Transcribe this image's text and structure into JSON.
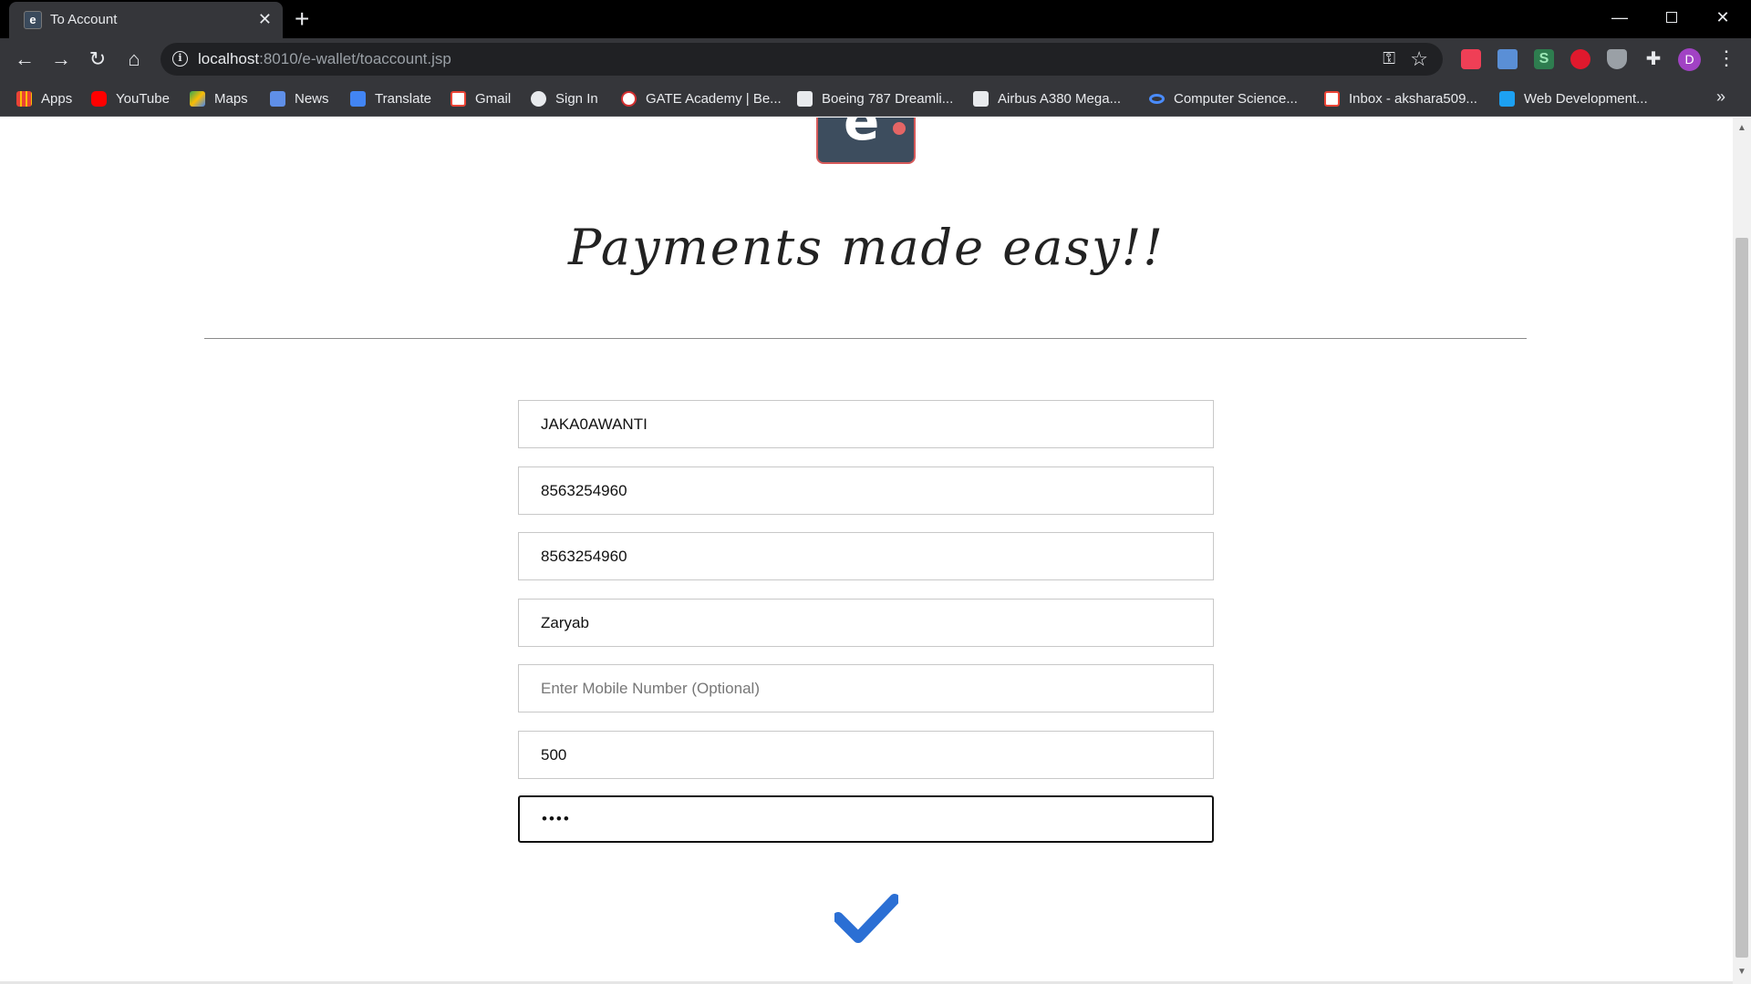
{
  "browser": {
    "tab_title": "To Account",
    "tab_favicon_letter": "e",
    "url_host": "localhost",
    "url_path": ":8010/e-wallet/toaccount.jsp",
    "avatar_letter": "D"
  },
  "bookmarks": [
    {
      "label": "Apps",
      "icon": "apps-grid-icon",
      "color": "#4285f4"
    },
    {
      "label": "YouTube",
      "icon": "youtube-icon",
      "color": "#ff0000"
    },
    {
      "label": "Maps",
      "icon": "maps-icon",
      "color": "#34a853"
    },
    {
      "label": "News",
      "icon": "news-icon",
      "color": "#4285f4"
    },
    {
      "label": "Translate",
      "icon": "translate-icon",
      "color": "#4285f4"
    },
    {
      "label": "Gmail",
      "icon": "gmail-icon",
      "color": "#ea4335"
    },
    {
      "label": "Sign In",
      "icon": "globe-icon",
      "color": "#e8eaed"
    },
    {
      "label": "GATE Academy | Be...",
      "icon": "gate-academy-icon",
      "color": "#d32f2f"
    },
    {
      "label": "Boeing 787 Dreamli...",
      "icon": "page-f-icon",
      "color": "#e8eaed"
    },
    {
      "label": "Airbus A380 Mega...",
      "icon": "page-f-icon",
      "color": "#e8eaed"
    },
    {
      "label": "Computer Science...",
      "icon": "coursera-icon",
      "color": "#4a8cff"
    },
    {
      "label": "Inbox - akshara509...",
      "icon": "gmail-icon",
      "color": "#ea4335"
    },
    {
      "label": "Web Development...",
      "icon": "is-icon",
      "color": "#1da1f2"
    }
  ],
  "page": {
    "heading": "Payments made easy!!",
    "fields": [
      {
        "value": "JAKA0AWANTI",
        "placeholder": ""
      },
      {
        "value": "8563254960",
        "placeholder": ""
      },
      {
        "value": "8563254960",
        "placeholder": ""
      },
      {
        "value": "Zaryab",
        "placeholder": ""
      },
      {
        "value": "",
        "placeholder": "Enter Mobile Number (Optional)"
      },
      {
        "value": "500",
        "placeholder": ""
      },
      {
        "value": "••••",
        "placeholder": ""
      }
    ]
  },
  "colors": {
    "browser_chrome": "#35363a",
    "submit_check": "#2b6fd4",
    "logo_bg": "#3d4d5e",
    "logo_accent": "#e46565"
  }
}
